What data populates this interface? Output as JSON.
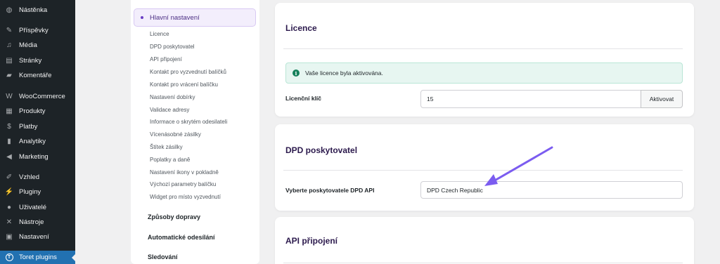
{
  "wp_menu": [
    {
      "label": "Nástěnka",
      "icon": "dashboard-icon",
      "glyph": "◍"
    },
    {
      "label": "Příspěvky",
      "icon": "pin-icon",
      "glyph": "✎"
    },
    {
      "label": "Média",
      "icon": "media-icon",
      "glyph": "♫"
    },
    {
      "label": "Stránky",
      "icon": "pages-icon",
      "glyph": "▤"
    },
    {
      "label": "Komentáře",
      "icon": "comment-icon",
      "glyph": "▰"
    },
    {
      "label": "WooCommerce",
      "icon": "woocommerce-icon",
      "glyph": "W"
    },
    {
      "label": "Produkty",
      "icon": "products-icon",
      "glyph": "▦"
    },
    {
      "label": "Platby",
      "icon": "payments-icon",
      "glyph": "$"
    },
    {
      "label": "Analytiky",
      "icon": "analytics-icon",
      "glyph": "▮"
    },
    {
      "label": "Marketing",
      "icon": "megaphone-icon",
      "glyph": "◀"
    },
    {
      "label": "Vzhled",
      "icon": "brush-icon",
      "glyph": "✐"
    },
    {
      "label": "Pluginy",
      "icon": "plugin-icon",
      "glyph": "⚡"
    },
    {
      "label": "Uživatelé",
      "icon": "users-icon",
      "glyph": "●"
    },
    {
      "label": "Nástroje",
      "icon": "wrench-icon",
      "glyph": "✕"
    },
    {
      "label": "Nastavení",
      "icon": "settings-icon",
      "glyph": "▣"
    },
    {
      "label": "Toret plugins",
      "icon": "toret-icon",
      "glyph": "T"
    }
  ],
  "subnav": {
    "header": "Hlavní nastavení",
    "links": [
      "Licence",
      "DPD poskytovatel",
      "API připojení",
      "Kontakt pro vyzvednutí balíčků",
      "Kontakt pro vrácení balíčku",
      "Nastavení dobírky",
      "Validace adresy",
      "Informace o skrytém odesilateli",
      "Vícenásobné zásilky",
      "Štítek zásilky",
      "Poplatky a daně",
      "Nastavení ikony v pokladně",
      "Výchozí parametry balíčku",
      "Widget pro místo vyzvednutí"
    ],
    "groups": [
      "Způsoby dopravy",
      "Automatické odesílání",
      "Sledování"
    ]
  },
  "licence": {
    "title": "Licence",
    "notice": "Vaše licence byla aktivována.",
    "key_label": "Licenční klíč",
    "key_value": "15",
    "activate_button": "Aktivovat"
  },
  "dpd_provider": {
    "title": "DPD poskytovatel",
    "select_label": "Vyberte poskytovatele DPD API",
    "select_value": "DPD Czech Republic"
  },
  "api": {
    "title": "API připojení"
  },
  "colors": {
    "sidebar_bg": "#1d2327",
    "active_menu": "#2271b1",
    "accent_purple": "#6a3fc4",
    "arrow": "#7b5cf0",
    "notice_bg": "#e7f6f1"
  }
}
